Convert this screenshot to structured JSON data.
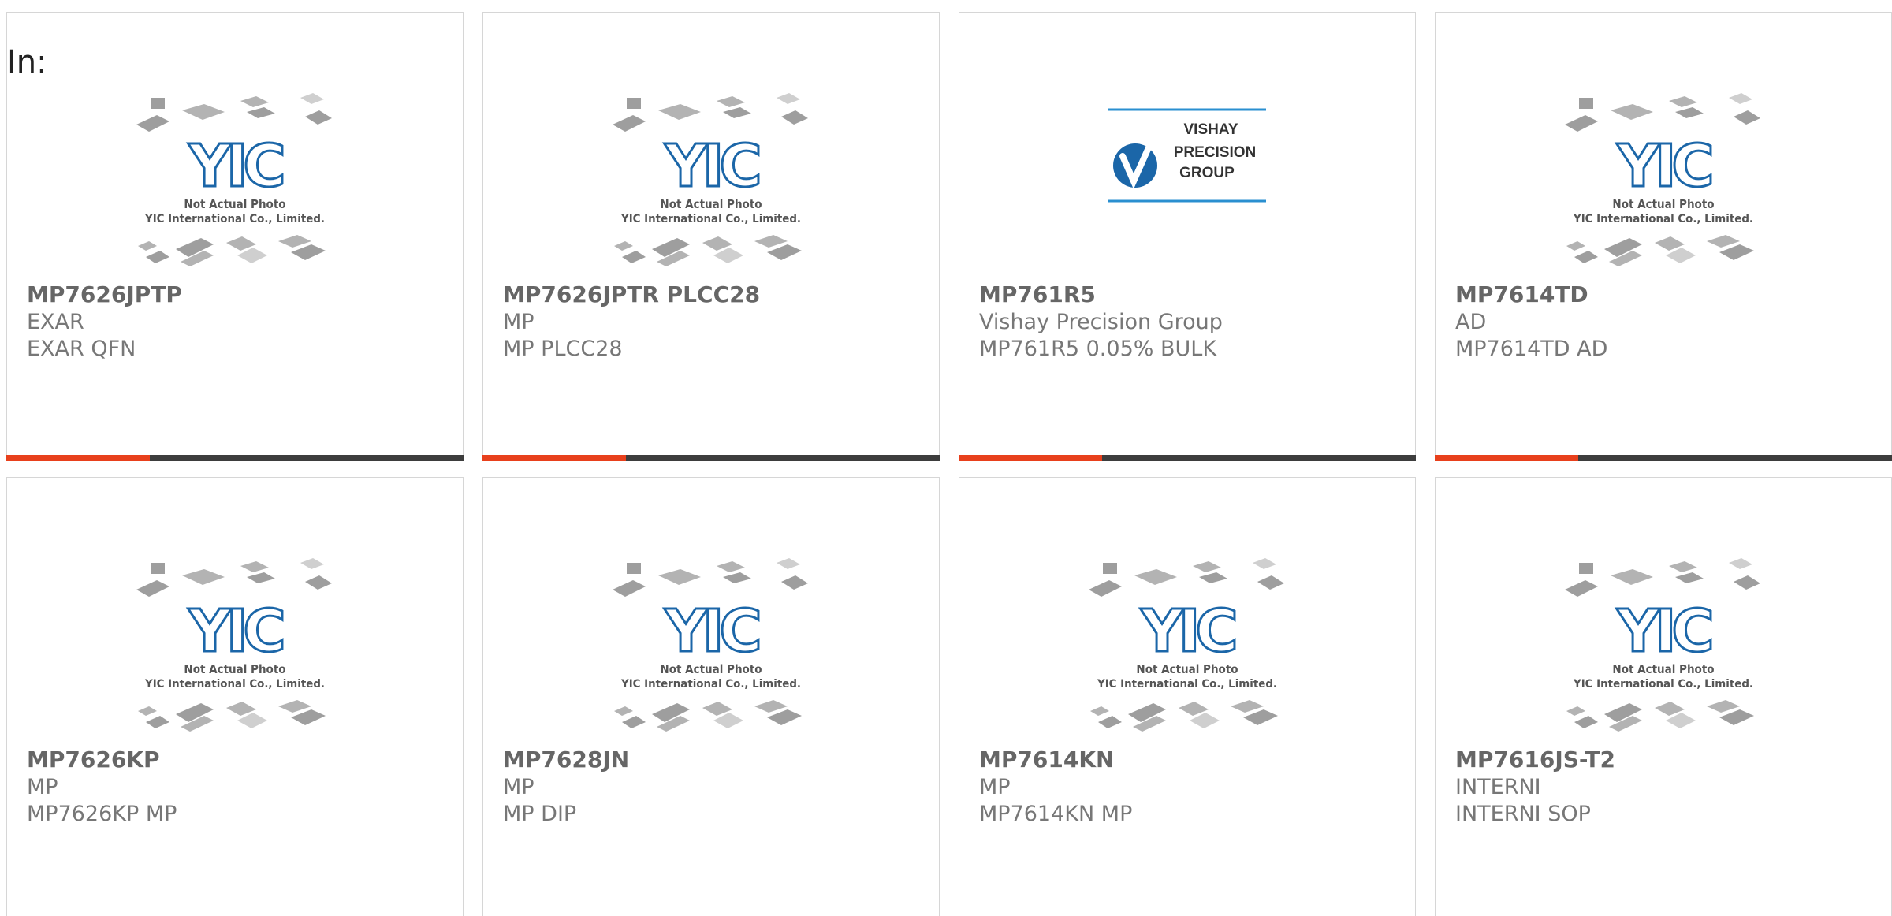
{
  "header": {
    "in_label": "In:"
  },
  "colors": {
    "accent": "#e8401c",
    "bar": "#3d3d3d",
    "logo_blue": "#1b66a8"
  },
  "placeholder": {
    "line1": "Not Actual Photo",
    "line2": "YIC International Co., Limited.",
    "logo": "YIC"
  },
  "vishay_logo": {
    "line1": "VISHAY",
    "line2": "PRECISION",
    "line3": "GROUP"
  },
  "products": [
    {
      "part": "MP7626JPTP",
      "manufacturer": "EXAR",
      "description": "EXAR QFN",
      "image": "yic-placeholder"
    },
    {
      "part": "MP7626JPTR PLCC28",
      "manufacturer": "MP",
      "description": "MP PLCC28",
      "image": "yic-placeholder"
    },
    {
      "part": "MP761R5",
      "manufacturer": "Vishay Precision Group",
      "description": "MP761R5 0.05% BULK",
      "image": "vishay-logo"
    },
    {
      "part": "MP7614TD",
      "manufacturer": "AD",
      "description": "MP7614TD AD",
      "image": "yic-placeholder"
    },
    {
      "part": "MP7626KP",
      "manufacturer": "MP",
      "description": "MP7626KP MP",
      "image": "yic-placeholder"
    },
    {
      "part": "MP7628JN",
      "manufacturer": "MP",
      "description": "MP DIP",
      "image": "yic-placeholder"
    },
    {
      "part": "MP7614KN",
      "manufacturer": "MP",
      "description": "MP7614KN MP",
      "image": "yic-placeholder"
    },
    {
      "part": "MP7616JS-T2",
      "manufacturer": "INTERNI",
      "description": "INTERNI SOP",
      "image": "yic-placeholder"
    }
  ]
}
